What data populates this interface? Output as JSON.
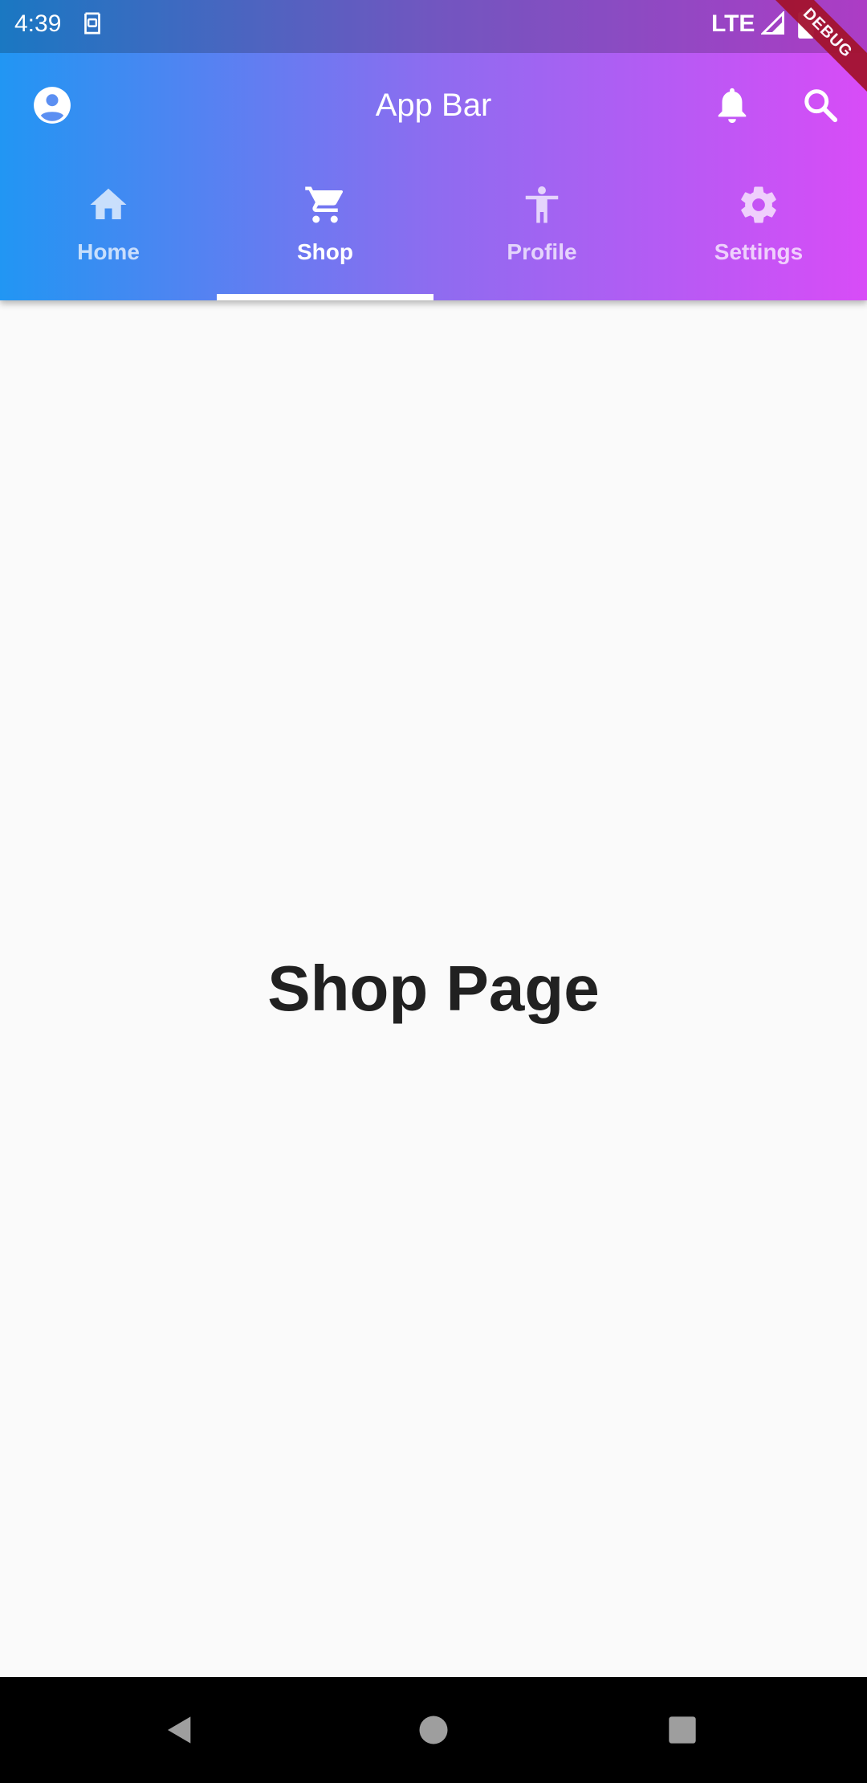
{
  "status_bar": {
    "time": "4:39",
    "network": "LTE",
    "notification_icon": "sim-card-icon",
    "signal_icon": "signal-icon",
    "battery_icon": "battery-icon"
  },
  "debug_banner": "DEBUG",
  "app_bar": {
    "title": "App Bar",
    "leading_icon": "account-circle-icon",
    "actions": [
      "bell-icon",
      "search-icon"
    ]
  },
  "tabs": [
    {
      "label": "Home",
      "icon": "home-icon",
      "selected": false
    },
    {
      "label": "Shop",
      "icon": "cart-icon",
      "selected": true
    },
    {
      "label": "Profile",
      "icon": "accessibility-icon",
      "selected": false
    },
    {
      "label": "Settings",
      "icon": "gear-icon",
      "selected": false
    }
  ],
  "content": {
    "heading": "Shop Page"
  },
  "nav_bar": {
    "buttons": [
      "back-icon",
      "home-circle-icon",
      "recents-icon"
    ]
  },
  "colors": {
    "gradient_start": "#2196f3",
    "gradient_end": "#d84cf7",
    "background": "#fafafa",
    "heading_text": "#212121",
    "tab_indicator": "#ffffff",
    "debug_ribbon": "#a3132f"
  }
}
